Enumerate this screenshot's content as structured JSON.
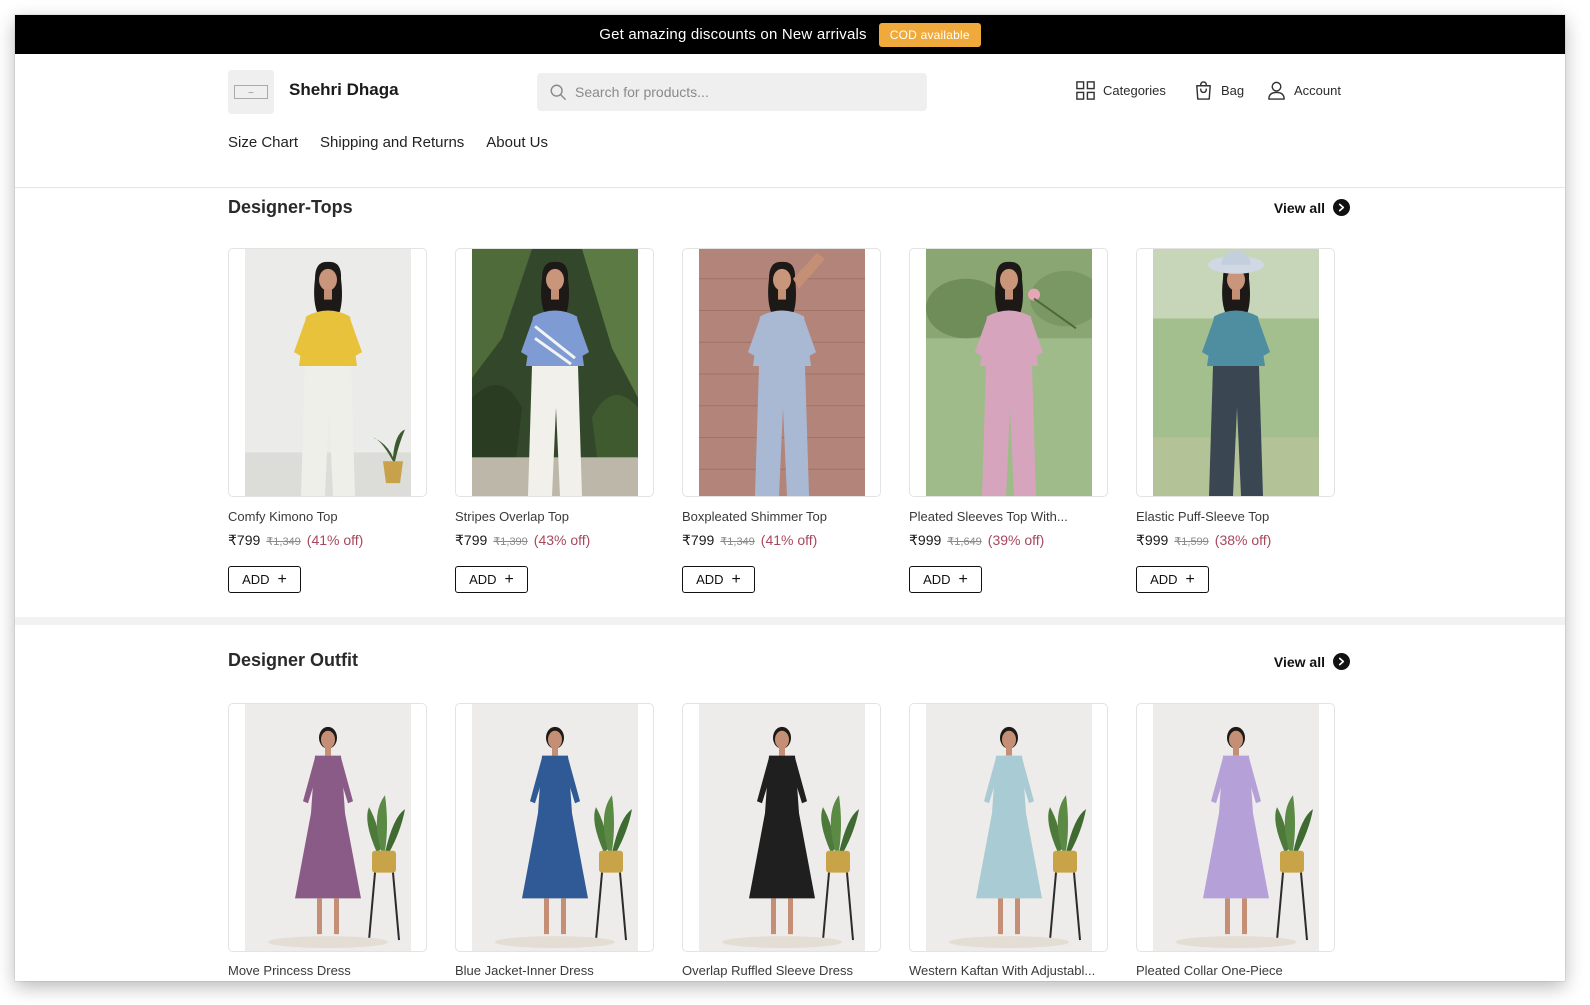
{
  "announcement": {
    "text": "Get amazing discounts on New arrivals",
    "badge": "COD available"
  },
  "header": {
    "brand": "Shehri Dhaga",
    "search_placeholder": "Search for products...",
    "nav": {
      "categories": "Categories",
      "bag": "Bag",
      "account": "Account"
    },
    "links": [
      "Size Chart",
      "Shipping and Returns",
      "About Us"
    ]
  },
  "sections": [
    {
      "title": "Designer-Tops",
      "view_all": "View all",
      "products": [
        {
          "name": "Comfy Kimono Top",
          "price": "₹799",
          "mrp": "₹1,349",
          "off": "(41% off)",
          "add": "ADD"
        },
        {
          "name": "Stripes Overlap Top",
          "price": "₹799",
          "mrp": "₹1,399",
          "off": "(43% off)",
          "add": "ADD"
        },
        {
          "name": "Boxpleated Shimmer Top",
          "price": "₹799",
          "mrp": "₹1,349",
          "off": "(41% off)",
          "add": "ADD"
        },
        {
          "name": "Pleated Sleeves Top With...",
          "price": "₹999",
          "mrp": "₹1,649",
          "off": "(39% off)",
          "add": "ADD"
        },
        {
          "name": "Elastic Puff-Sleeve Top",
          "price": "₹999",
          "mrp": "₹1,599",
          "off": "(38% off)",
          "add": "ADD"
        }
      ]
    },
    {
      "title": "Designer Outfit",
      "view_all": "View all",
      "products": [
        {
          "name": "Move Princess Dress"
        },
        {
          "name": "Blue Jacket-Inner Dress"
        },
        {
          "name": "Overlap Ruffled Sleeve Dress"
        },
        {
          "name": "Western Kaftan With Adjustabl..."
        },
        {
          "name": "Pleated Collar One-Piece"
        }
      ]
    }
  ],
  "colors": {
    "announce_bg": "#000000",
    "badge_bg": "#f0a93b",
    "discount_text": "#a8475c",
    "search_bg": "#efefef"
  },
  "icons": {
    "search": "search-icon",
    "categories": "grid-icon",
    "bag": "shopping-bag-icon",
    "account": "user-icon",
    "view_all": "arrow-right-circle-icon",
    "add": "plus-icon"
  }
}
